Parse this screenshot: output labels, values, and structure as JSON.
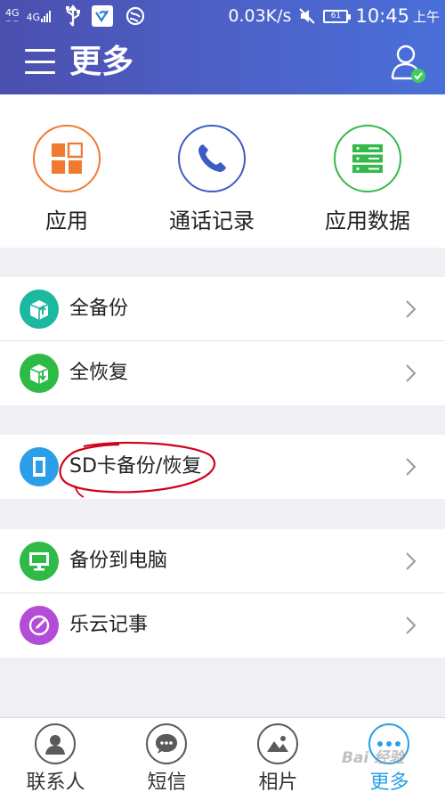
{
  "status_bar": {
    "network_top": "4G",
    "network_sub": "ᅩ ᅮ",
    "network_main": "4G",
    "speed": "0.03K/s",
    "battery": "61",
    "time": "10:45",
    "ampm": "上午",
    "icons": [
      "signal-icon",
      "usb-icon",
      "app-notification-icon",
      "globe-icon",
      "mute-icon",
      "battery-icon"
    ]
  },
  "header": {
    "title": "更多",
    "menu_icon": "menu-icon",
    "user_icon": "user-check-icon"
  },
  "quick_actions": [
    {
      "label": "应用",
      "icon": "apps-grid-icon",
      "color": "#f07a30"
    },
    {
      "label": "通话记录",
      "icon": "phone-icon",
      "color": "#3d5bc4"
    },
    {
      "label": "应用数据",
      "icon": "database-icon",
      "color": "#35b94a"
    }
  ],
  "groups": [
    [
      {
        "label": "全备份",
        "icon": "backup-box-icon",
        "color": "#1cb8a0"
      },
      {
        "label": "全恢复",
        "icon": "restore-box-icon",
        "color": "#2fba48"
      }
    ],
    [
      {
        "label": "SD卡备份/恢复",
        "icon": "sd-card-icon",
        "color": "#2a9ee8"
      }
    ],
    [
      {
        "label": "备份到电脑",
        "icon": "computer-icon",
        "color": "#2fba48"
      },
      {
        "label": "乐云记事",
        "icon": "note-pen-icon",
        "color": "#b34dd6"
      }
    ]
  ],
  "bottom_nav": [
    {
      "label": "联系人",
      "icon": "contacts-icon",
      "active": false
    },
    {
      "label": "短信",
      "icon": "message-icon",
      "active": false
    },
    {
      "label": "相片",
      "icon": "photo-icon",
      "active": false
    },
    {
      "label": "更多",
      "icon": "more-dots-icon",
      "active": true
    }
  ],
  "watermark": "Bai 经验",
  "colors": {
    "header_start": "#4b4fae",
    "header_end": "#4a6fd9",
    "active_tab": "#2aa0e6",
    "annotation": "#d0021b"
  }
}
